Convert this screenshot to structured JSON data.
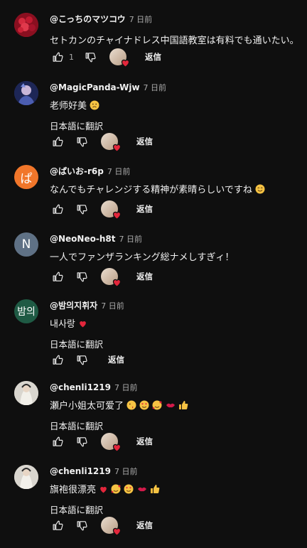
{
  "comments": [
    {
      "handle": "@こっちのマツコウ",
      "time": "7 日前",
      "avatar_color": "#b1172c",
      "text": "セトカンのチャイナドレス中国語教室は有料でも通いたい。",
      "likes": "1",
      "translate": "",
      "reply": "返信"
    },
    {
      "handle": "@MagicPanda-Wjw",
      "time": "7 日前",
      "avatar_color": "#23306a",
      "text": "老师好美",
      "translate": "日本語に翻訳",
      "reply": "返信"
    },
    {
      "handle": "@ぱいお-r6p",
      "time": "7 日前",
      "avatar_letter": "ぱ",
      "avatar_color": "#f1762a",
      "text": "なんでもチャレンジする精神が素晴らしいですね",
      "translate": "",
      "reply": "返信"
    },
    {
      "handle": "@NeoNeo-h8t",
      "time": "7 日前",
      "avatar_letter": "N",
      "avatar_color": "#5f7185",
      "text": "一人でファンザランキング総ナメしすぎィ！",
      "translate": "",
      "reply": "返信"
    },
    {
      "handle": "@밤의지휘자",
      "time": "7 日前",
      "avatar_letter": "밤의",
      "avatar_color": "#1f5a44",
      "text": "내사랑",
      "translate": "日本語に翻訳",
      "reply": "返信"
    },
    {
      "handle": "@chenli1219",
      "time": "7 日前",
      "avatar_color": "#c9c5bd",
      "text": "瀬户小姐太可爱了",
      "translate": "日本語に翻訳",
      "reply": "返信"
    },
    {
      "handle": "@chenli1219",
      "time": "7 日前",
      "avatar_color": "#c9c5bd",
      "text": "旗袍很漂亮",
      "translate": "日本語に翻訳",
      "reply": "返信"
    }
  ],
  "colors": {
    "background": "#0f0f0f",
    "heart": "#e3263b",
    "secondary_text": "#aaaaaa"
  },
  "icons": [
    "thumbs-up-icon",
    "thumbs-down-icon",
    "creator-heart-icon"
  ]
}
